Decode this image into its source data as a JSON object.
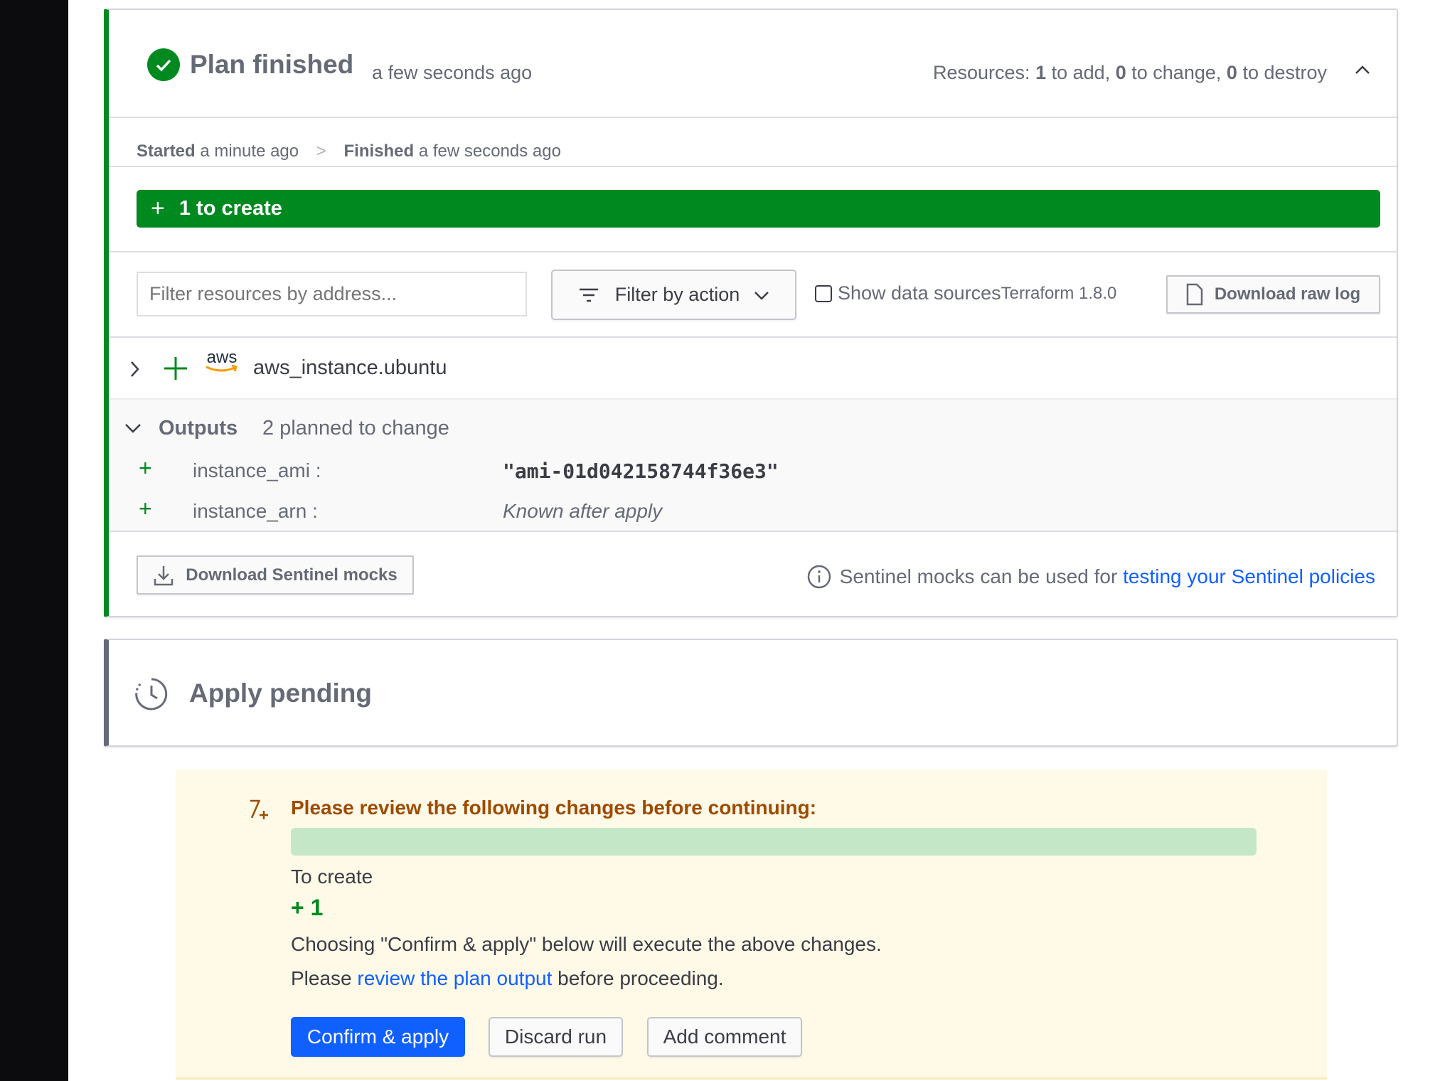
{
  "plan": {
    "title": "Plan finished",
    "time": "a few seconds ago",
    "resources": {
      "prefix": "Resources:",
      "add": "1",
      "add_label": "to add,",
      "change": "0",
      "change_label": "to change,",
      "destroy": "0",
      "destroy_label": "to destroy"
    },
    "timeline": {
      "started_label": "Started",
      "started_time": "a minute ago",
      "sep": ">",
      "finished_label": "Finished",
      "finished_time": "a few seconds ago"
    },
    "create_bar": "1 to create",
    "filter_placeholder": "Filter resources by address...",
    "filter_action": "Filter by action",
    "show_data_sources": "Show data sources",
    "show_data_sources_checked": false,
    "terraform_version": "Terraform 1.8.0",
    "download_raw_log": "Download raw log",
    "resource": {
      "provider": "aws",
      "address": "aws_instance.ubuntu"
    },
    "outputs": {
      "label": "Outputs",
      "summary": "2 planned to change",
      "items": [
        {
          "key": "instance_ami :",
          "value": "\"ami-01d042158744f36e3\""
        },
        {
          "key": "instance_arn :",
          "value": "Known after apply"
        }
      ]
    },
    "download_mocks": "Download Sentinel mocks",
    "mocks_info": "Sentinel mocks can be used for",
    "mocks_link": "testing your Sentinel policies"
  },
  "apply": {
    "title": "Apply pending"
  },
  "review": {
    "heading": "Please review the following changes before continuing:",
    "to_create_label": "To create",
    "to_create_count": "+ 1",
    "text1": "Choosing \"Confirm & apply\" below will execute the above changes.",
    "text2_prefix": "Please",
    "text2_link": "review the plan output",
    "text2_suffix": "before proceeding.",
    "confirm": "Confirm & apply",
    "discard": "Discard run",
    "comment": "Add comment"
  },
  "colors": {
    "success": "#00891f",
    "primary": "#1060ff",
    "warning_text": "#9e4b00",
    "warning_bg": "#fff9e8"
  }
}
